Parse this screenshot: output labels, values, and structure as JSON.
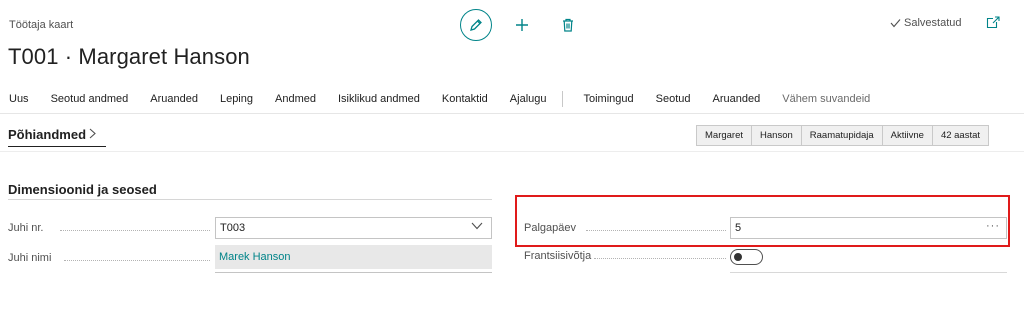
{
  "header": {
    "breadcrumb": "Töötaja kaart",
    "title": "T001 · Margaret Hanson",
    "saved_label": "Salvestatud"
  },
  "toolbar": {
    "icons": [
      "edit-icon",
      "plus-icon",
      "trash-icon",
      "popout-icon"
    ]
  },
  "action_bar": {
    "items": [
      "Uus",
      "Seotud andmed",
      "Aruanded",
      "Leping",
      "Andmed",
      "Isiklikud andmed",
      "Kontaktid",
      "Ajalugu"
    ],
    "items2": [
      "Toimingud",
      "Seotud",
      "Aruanded"
    ],
    "fewer_options": "Vähem suvandeid"
  },
  "general": {
    "title": "Põhiandmed",
    "chips": [
      "Margaret",
      "Hanson",
      "Raamatupidaja",
      "Aktiivne",
      "42 aastat"
    ]
  },
  "dimensions": {
    "title": "Dimensioonid ja seosed",
    "manager_no_label": "Juhi nr.",
    "manager_no_value": "T003",
    "manager_name_label": "Juhi nimi",
    "manager_name_value": "Marek Hanson",
    "payday_label": "Palgapäev",
    "payday_value": "5",
    "franchise_label": "Frantsiisivõtja",
    "franchise_on": false
  },
  "colors": {
    "accent": "#008489",
    "highlight": "#e01a1a"
  }
}
